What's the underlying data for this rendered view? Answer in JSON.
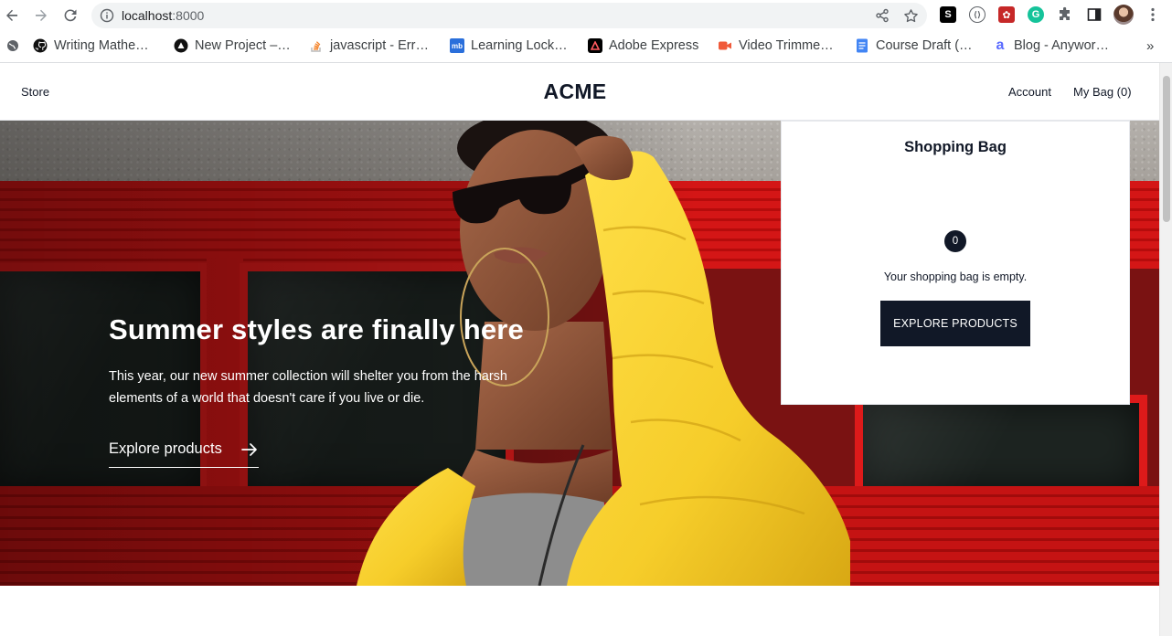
{
  "browser": {
    "url_host": "localhost",
    "url_port": ":8000",
    "icons": {
      "back": "arrow-left-icon",
      "forward": "arrow-right-icon",
      "reload": "reload-icon",
      "info": "info-icon",
      "share": "share-icon",
      "bookmark_star": "star-icon",
      "menu": "kebab-menu-icon"
    },
    "extensions": [
      {
        "name": "s-extension-icon",
        "glyph": "S",
        "color": "#000000"
      },
      {
        "name": "code-extension-icon",
        "glyph": "⟨⟩",
        "color": "#5f6368"
      },
      {
        "name": "red-extension-icon",
        "glyph": "✿",
        "color": "#c62828"
      },
      {
        "name": "grammarly-extension-icon",
        "glyph": "G",
        "color": "#15c39a"
      },
      {
        "name": "puzzle-extension-icon",
        "glyph": "",
        "color": "#5f6368"
      }
    ],
    "bookmarks": [
      {
        "label": "Writing Mathe…",
        "icon": "github-icon"
      },
      {
        "label": "New Project –…",
        "icon": "triangle-logo-icon"
      },
      {
        "label": "javascript - Err…",
        "icon": "stackoverflow-icon"
      },
      {
        "label": "Learning Lock…",
        "icon": "mb-logo-icon"
      },
      {
        "label": "Adobe Express",
        "icon": "adobe-express-icon"
      },
      {
        "label": "Video Trimme…",
        "icon": "video-icon"
      },
      {
        "label": "Course Draft (…",
        "icon": "google-docs-icon"
      },
      {
        "label": "Blog - Anywor…",
        "icon": "anyword-icon"
      }
    ],
    "more_bookmarks": "»"
  },
  "site": {
    "nav": {
      "store": "Store",
      "brand": "ACME",
      "account": "Account",
      "bag": "My Bag (0)"
    },
    "hero": {
      "title": "Summer styles are finally here",
      "text": "This year, our new summer collection will shelter you from the harsh elements of a world that doesn't care if you live or die.",
      "link": "Explore products"
    },
    "bag_panel": {
      "title": "Shopping Bag",
      "count": "0",
      "empty_text": "Your shopping bag is empty.",
      "button": "EXPLORE PRODUCTS"
    }
  },
  "colors": {
    "primary_dark": "#111827",
    "hero_red": "#d41616",
    "jacket_yellow": "#f6cd2a"
  }
}
